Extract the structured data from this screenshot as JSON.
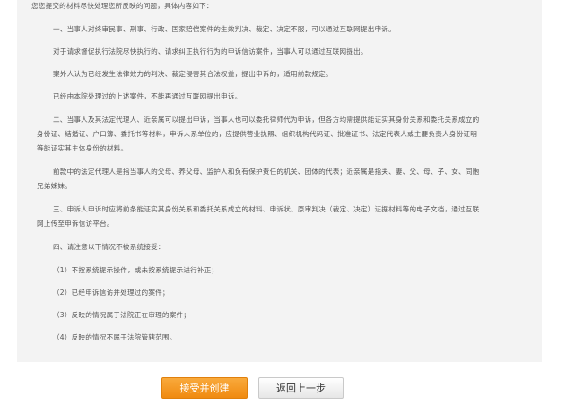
{
  "notice": {
    "intro": "您您提交的材料尽快处理您所反映的问题，具体内容如下：",
    "p1": "一、当事人对终审民事、刑事、行政、国家赔偿案件的生效判决、裁定、决定不服，可以通过互联网提出申诉。",
    "p2": "对于请求督促执行法院尽快执行的、请求纠正执行行为的申诉信访案件，当事人可以通过互联网提出。",
    "p3": "案外人认为已经发生法律效力的判决、裁定侵害其合法权益，提出申诉的，适用前款规定。",
    "p4": "已经由本院处理过的上述案件，不能再通过互联网提出申诉。",
    "p5a": "二、当事人及其法定代理人、近亲属可以提出申诉，当事人也可以委托律师代为申诉，但各方均需提供能证实其身份关系和委托关系成立的",
    "p5b": "身份证、结婚证、户口簿、委托书等材料，申诉人系单位的，应提供营业执照、组织机构代码证、批准证书、法定代表人或主要负责人身份证明",
    "p5c": "等能证实其主体身份的材料。",
    "p6a": "前款中的法定代理人是指当事人的父母、养父母、监护人和负有保护责任的机关、团体的代表；近亲属是指夫、妻、父、母、子、女、同胞",
    "p6b": "兄弟姊妹。",
    "p7a": "三、申诉人申诉时应将前条能证实其身份关系和委托关系成立的材料、申诉状、原审判决（裁定、决定）证据材料等的电子文档，通过互联",
    "p7b": "网上传至申诉信访平台。",
    "p8": "四、请注意以下情况不被系统接受：",
    "l1": "（1）不按系统提示操作，或未按系统提示进行补正；",
    "l2": "（2）已经申诉信访并处理过的案件；",
    "l3": "（3）反映的情况属于法院正在审理的案件；",
    "l4": "（4）反映的情况不属于法院管辖范围。"
  },
  "buttons": {
    "accept": "接受并创建",
    "back": "返回上一步"
  },
  "colors": {
    "accent": "#f39a1e",
    "panel": "#f3f3f3",
    "text": "#555555"
  }
}
